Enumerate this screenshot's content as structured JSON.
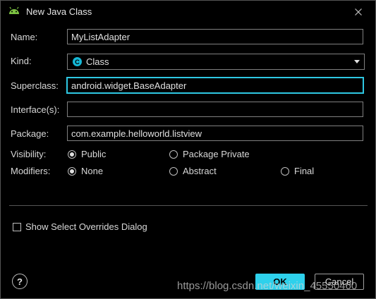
{
  "window": {
    "title": "New Java Class",
    "icon": "android-icon",
    "close_icon": "close-icon"
  },
  "form": {
    "name": {
      "label": "Name:",
      "value": "MyListAdapter"
    },
    "kind": {
      "label": "Kind:",
      "value": "Class",
      "icon_letter": "C",
      "icon_color": "#15b8d6"
    },
    "superclass": {
      "label": "Superclass:",
      "value": "android.widget.BaseAdapter"
    },
    "interfaces": {
      "label": "Interface(s):",
      "value": ""
    },
    "package": {
      "label": "Package:",
      "value": "com.example.helloworld.listview"
    },
    "visibility": {
      "label": "Visibility:",
      "options": [
        {
          "label": "Public",
          "selected": true
        },
        {
          "label": "Package Private",
          "selected": false
        }
      ]
    },
    "modifiers": {
      "label": "Modifiers:",
      "options": [
        {
          "label": "None",
          "selected": true
        },
        {
          "label": "Abstract",
          "selected": false
        },
        {
          "label": "Final",
          "selected": false
        }
      ]
    },
    "overrides_checkbox": {
      "label": "Show Select Overrides Dialog",
      "checked": false
    }
  },
  "footer": {
    "help_label": "?",
    "ok_label": "OK",
    "cancel_label": "Cancel"
  },
  "watermark": "https://blog.csdn.net/weixin_45550460",
  "colors": {
    "accent": "#2ed1ec",
    "focus_border": "#2ec8e3",
    "background": "#000000",
    "text": "#d8d8d8"
  }
}
